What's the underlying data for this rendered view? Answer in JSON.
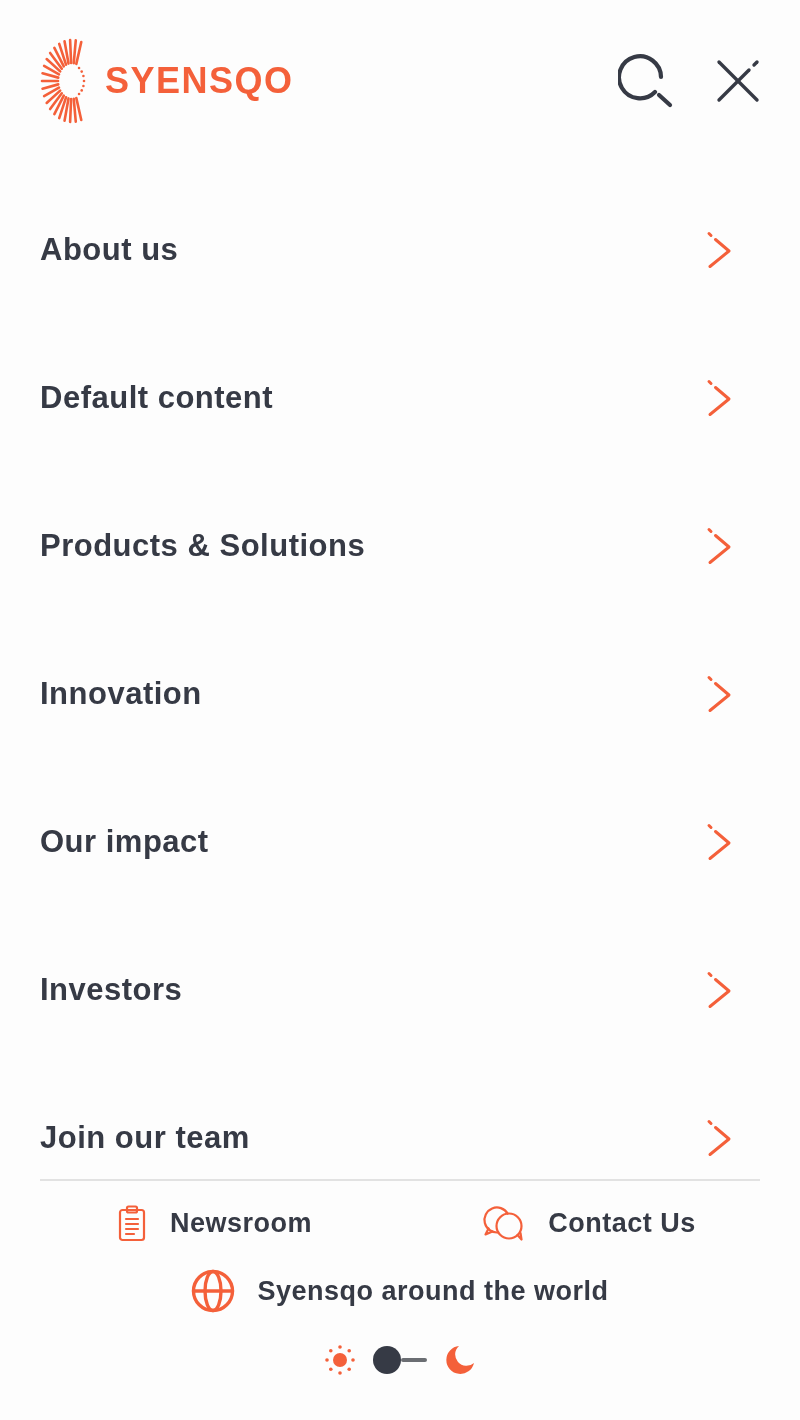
{
  "header": {
    "logo": {
      "wordmark": "SYENSQO"
    }
  },
  "menu": {
    "items": [
      {
        "label": "About us"
      },
      {
        "label": "Default content"
      },
      {
        "label": "Products & Solutions"
      },
      {
        "label": "Innovation"
      },
      {
        "label": "Our impact"
      },
      {
        "label": "Investors"
      },
      {
        "label": "Join our team"
      }
    ]
  },
  "footer": {
    "links": [
      {
        "kind": "newsroom",
        "label": "Newsroom"
      },
      {
        "kind": "contact",
        "label": "Contact Us"
      },
      {
        "kind": "world",
        "label": "Syensqo around the world"
      }
    ],
    "theme_toggle": {
      "dark": false
    }
  }
}
